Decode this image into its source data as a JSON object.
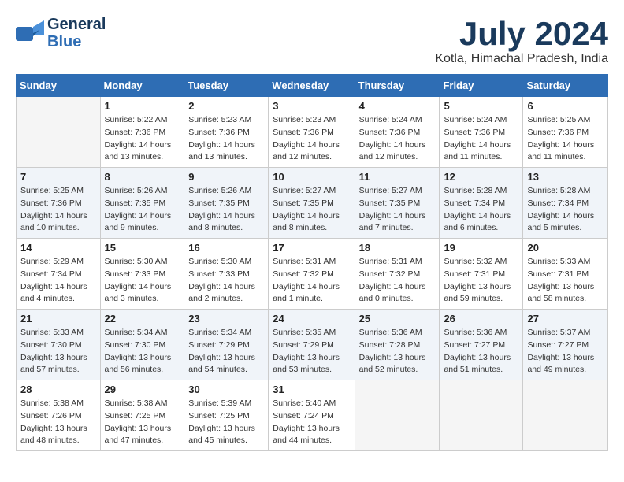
{
  "header": {
    "logo_line1": "General",
    "logo_line2": "Blue",
    "month": "July 2024",
    "location": "Kotla, Himachal Pradesh, India"
  },
  "weekdays": [
    "Sunday",
    "Monday",
    "Tuesday",
    "Wednesday",
    "Thursday",
    "Friday",
    "Saturday"
  ],
  "weeks": [
    [
      {
        "day": "",
        "info": ""
      },
      {
        "day": "1",
        "info": "Sunrise: 5:22 AM\nSunset: 7:36 PM\nDaylight: 14 hours\nand 13 minutes."
      },
      {
        "day": "2",
        "info": "Sunrise: 5:23 AM\nSunset: 7:36 PM\nDaylight: 14 hours\nand 13 minutes."
      },
      {
        "day": "3",
        "info": "Sunrise: 5:23 AM\nSunset: 7:36 PM\nDaylight: 14 hours\nand 12 minutes."
      },
      {
        "day": "4",
        "info": "Sunrise: 5:24 AM\nSunset: 7:36 PM\nDaylight: 14 hours\nand 12 minutes."
      },
      {
        "day": "5",
        "info": "Sunrise: 5:24 AM\nSunset: 7:36 PM\nDaylight: 14 hours\nand 11 minutes."
      },
      {
        "day": "6",
        "info": "Sunrise: 5:25 AM\nSunset: 7:36 PM\nDaylight: 14 hours\nand 11 minutes."
      }
    ],
    [
      {
        "day": "7",
        "info": "Sunrise: 5:25 AM\nSunset: 7:36 PM\nDaylight: 14 hours\nand 10 minutes."
      },
      {
        "day": "8",
        "info": "Sunrise: 5:26 AM\nSunset: 7:35 PM\nDaylight: 14 hours\nand 9 minutes."
      },
      {
        "day": "9",
        "info": "Sunrise: 5:26 AM\nSunset: 7:35 PM\nDaylight: 14 hours\nand 8 minutes."
      },
      {
        "day": "10",
        "info": "Sunrise: 5:27 AM\nSunset: 7:35 PM\nDaylight: 14 hours\nand 8 minutes."
      },
      {
        "day": "11",
        "info": "Sunrise: 5:27 AM\nSunset: 7:35 PM\nDaylight: 14 hours\nand 7 minutes."
      },
      {
        "day": "12",
        "info": "Sunrise: 5:28 AM\nSunset: 7:34 PM\nDaylight: 14 hours\nand 6 minutes."
      },
      {
        "day": "13",
        "info": "Sunrise: 5:28 AM\nSunset: 7:34 PM\nDaylight: 14 hours\nand 5 minutes."
      }
    ],
    [
      {
        "day": "14",
        "info": "Sunrise: 5:29 AM\nSunset: 7:34 PM\nDaylight: 14 hours\nand 4 minutes."
      },
      {
        "day": "15",
        "info": "Sunrise: 5:30 AM\nSunset: 7:33 PM\nDaylight: 14 hours\nand 3 minutes."
      },
      {
        "day": "16",
        "info": "Sunrise: 5:30 AM\nSunset: 7:33 PM\nDaylight: 14 hours\nand 2 minutes."
      },
      {
        "day": "17",
        "info": "Sunrise: 5:31 AM\nSunset: 7:32 PM\nDaylight: 14 hours\nand 1 minute."
      },
      {
        "day": "18",
        "info": "Sunrise: 5:31 AM\nSunset: 7:32 PM\nDaylight: 14 hours\nand 0 minutes."
      },
      {
        "day": "19",
        "info": "Sunrise: 5:32 AM\nSunset: 7:31 PM\nDaylight: 13 hours\nand 59 minutes."
      },
      {
        "day": "20",
        "info": "Sunrise: 5:33 AM\nSunset: 7:31 PM\nDaylight: 13 hours\nand 58 minutes."
      }
    ],
    [
      {
        "day": "21",
        "info": "Sunrise: 5:33 AM\nSunset: 7:30 PM\nDaylight: 13 hours\nand 57 minutes."
      },
      {
        "day": "22",
        "info": "Sunrise: 5:34 AM\nSunset: 7:30 PM\nDaylight: 13 hours\nand 56 minutes."
      },
      {
        "day": "23",
        "info": "Sunrise: 5:34 AM\nSunset: 7:29 PM\nDaylight: 13 hours\nand 54 minutes."
      },
      {
        "day": "24",
        "info": "Sunrise: 5:35 AM\nSunset: 7:29 PM\nDaylight: 13 hours\nand 53 minutes."
      },
      {
        "day": "25",
        "info": "Sunrise: 5:36 AM\nSunset: 7:28 PM\nDaylight: 13 hours\nand 52 minutes."
      },
      {
        "day": "26",
        "info": "Sunrise: 5:36 AM\nSunset: 7:27 PM\nDaylight: 13 hours\nand 51 minutes."
      },
      {
        "day": "27",
        "info": "Sunrise: 5:37 AM\nSunset: 7:27 PM\nDaylight: 13 hours\nand 49 minutes."
      }
    ],
    [
      {
        "day": "28",
        "info": "Sunrise: 5:38 AM\nSunset: 7:26 PM\nDaylight: 13 hours\nand 48 minutes."
      },
      {
        "day": "29",
        "info": "Sunrise: 5:38 AM\nSunset: 7:25 PM\nDaylight: 13 hours\nand 47 minutes."
      },
      {
        "day": "30",
        "info": "Sunrise: 5:39 AM\nSunset: 7:25 PM\nDaylight: 13 hours\nand 45 minutes."
      },
      {
        "day": "31",
        "info": "Sunrise: 5:40 AM\nSunset: 7:24 PM\nDaylight: 13 hours\nand 44 minutes."
      },
      {
        "day": "",
        "info": ""
      },
      {
        "day": "",
        "info": ""
      },
      {
        "day": "",
        "info": ""
      }
    ]
  ]
}
